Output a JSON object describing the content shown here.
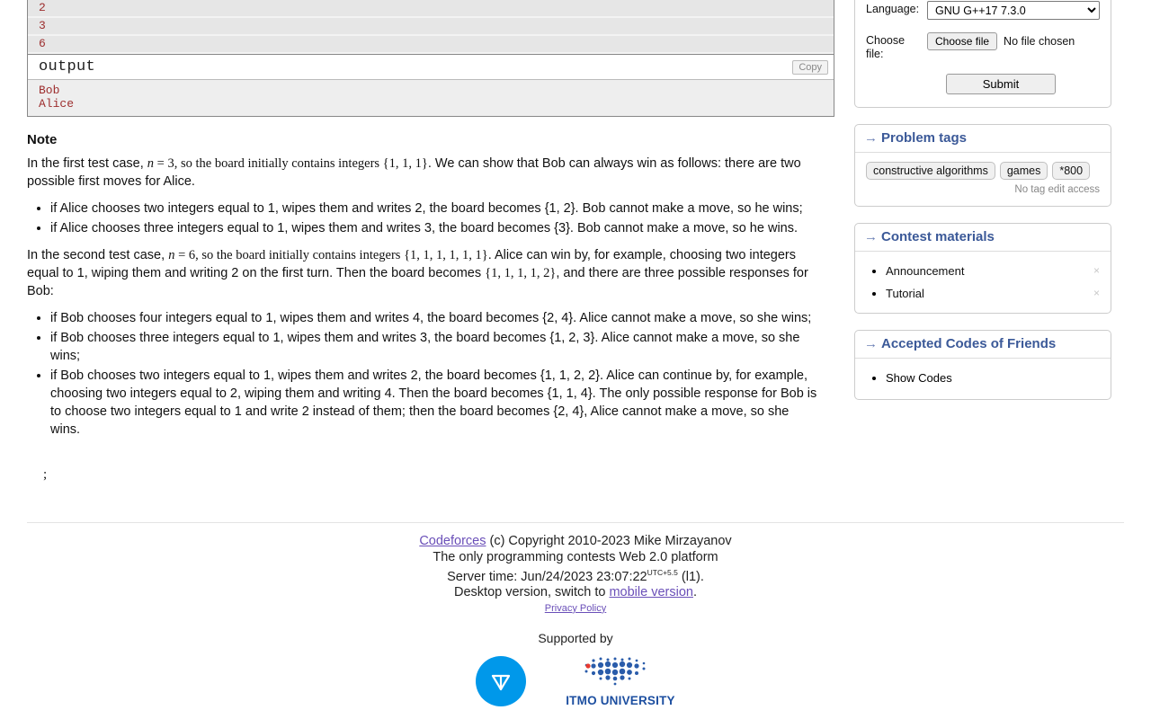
{
  "sample": {
    "input_lines": [
      "2",
      "3",
      "6"
    ],
    "output_title": "output",
    "copy_label": "Copy",
    "output_lines": [
      "Bob",
      "Alice"
    ]
  },
  "note": {
    "heading": "Note",
    "para1_a": "In the first test case, ",
    "para1_n": "n",
    "para1_b": " = 3, so the board initially contains integers ",
    "para1_set": "{1, 1, 1}",
    "para1_c": ". We can show that Bob can always win as follows: there are two possible first moves for Alice.",
    "list1": [
      "if Alice chooses two integers equal to 1, wipes them and writes 2, the board becomes {1, 2}. Bob cannot make a move, so he wins;",
      "if Alice chooses three integers equal to 1, wipes them and writes 3, the board becomes {3}. Bob cannot make a move, so he wins."
    ],
    "para2_a": "In the second test case, ",
    "para2_n": "n",
    "para2_b": " = 6, so the board initially contains integers ",
    "para2_set": "{1, 1, 1, 1, 1, 1}",
    "para2_c": ". Alice can win by, for example, choosing two integers equal to 1, wiping them and writing 2 on the first turn. Then the board becomes ",
    "para2_set2": "{1, 1, 1, 1, 2}",
    "para2_d": ", and there are three possible responses for Bob:",
    "list2": [
      "if Bob chooses four integers equal to 1, wipes them and writes 4, the board becomes {2, 4}. Alice cannot make a move, so she wins;",
      "if Bob chooses three integers equal to 1, wipes them and writes 3, the board becomes {1, 2, 3}. Alice cannot make a move, so she wins;",
      "if Bob chooses two integers equal to 1, wipes them and writes 2, the board becomes {1, 1, 2, 2}. Alice can continue by, for example, choosing two integers equal to 2, wiping them and writing 4. Then the board becomes {1, 1, 4}. The only possible response for Bob is to choose two integers equal to 1 and write 2 instead of them; then the board becomes {2, 4}, Alice cannot make a move, so she wins."
    ],
    "stray_text": ";"
  },
  "submit_form": {
    "language_label": "Language:",
    "language_value": "GNU G++17 7.3.0",
    "language_options": [
      "GNU G++17 7.3.0"
    ],
    "choose_file_label": "Choose\nfile:",
    "choose_file_label_line1": "Choose",
    "choose_file_label_line2": "file:",
    "choose_file_button": "Choose file",
    "no_file_text": "No file chosen",
    "submit_label": "Submit"
  },
  "problem_tags": {
    "title": "Problem tags",
    "arrow": "→",
    "tags": [
      "constructive algorithms",
      "games",
      "*800"
    ],
    "no_edit_text": "No tag edit access"
  },
  "contest_materials": {
    "title": "Contest materials",
    "arrow": "→",
    "items": [
      {
        "label": "Announcement",
        "close": "×"
      },
      {
        "label": "Tutorial",
        "close": "×"
      }
    ]
  },
  "accepted_codes": {
    "title": "Accepted Codes of Friends",
    "arrow": "→",
    "items": [
      "Show Codes"
    ]
  },
  "footer": {
    "brand": "Codeforces",
    "copyright": " (c) Copyright 2010-2023 Mike Mirzayanov",
    "tagline": "The only programming contests Web 2.0 platform",
    "server_time_prefix": "Server time: Jun/24/2023 23:07:22",
    "server_time_sup": "UTC+5.5",
    "server_time_suffix": " (l1).",
    "desktop_prefix": "Desktop version, switch to ",
    "mobile_link": "mobile version",
    "desktop_suffix": ".",
    "privacy": "Privacy Policy",
    "supported_by": "Supported by",
    "itmo_name": "ITMO UNIVERSITY"
  },
  "colors": {
    "accent_blue": "#3b5998",
    "sample_text_red": "#9d2e2e",
    "link_purple": "#6a4fb8",
    "ton_blue": "#0098ea",
    "itmo_blue": "#1d4fa0"
  }
}
